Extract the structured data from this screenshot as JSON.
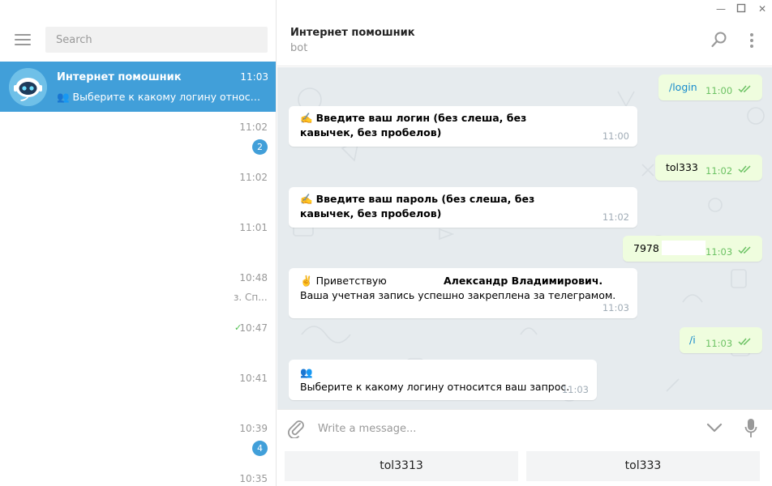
{
  "sidebar": {
    "search_placeholder": "Search",
    "active_chat": {
      "name": "Интернет помошник",
      "time": "11:03",
      "preview": "Выберите к какому логину относит..."
    },
    "chats": [
      {
        "time": "11:02",
        "badge": "2"
      },
      {
        "time": "11:02"
      },
      {
        "time": "11:01"
      },
      {
        "time": "10:48",
        "snippet": "з. Сп..."
      },
      {
        "time": "10:47"
      },
      {
        "time": "10:41"
      },
      {
        "time": "10:39",
        "badge": "4"
      },
      {
        "time": "10:35"
      }
    ]
  },
  "chat": {
    "title": "Интернет помошник",
    "subtitle": "bot",
    "messages": [
      {
        "dir": "out",
        "text": "/login",
        "time": "11:00"
      },
      {
        "dir": "in",
        "emoji": "✍️",
        "text": "Введите ваш логин (без слеша, без кавычек, без пробелов)",
        "time": "11:00"
      },
      {
        "dir": "out",
        "text": "tol333",
        "time": "11:02"
      },
      {
        "dir": "in",
        "emoji": "✍️",
        "text": "Введите ваш пароль (без слеша, без кавычек, без пробелов)",
        "time": "11:02"
      },
      {
        "dir": "out",
        "text": "7978",
        "time": "11:03"
      },
      {
        "dir": "in",
        "emoji": "✌️",
        "line1a": "Приветствую",
        "line1b": "Александр Владимирович.",
        "line2": "Ваша учетная запись успешно закреплена за телеграмом.",
        "time": "11:03"
      },
      {
        "dir": "out",
        "text": "/i",
        "time": "11:03"
      },
      {
        "dir": "in",
        "emoji": "👥",
        "text": "Выберите к какому логину относится ваш запрос.",
        "time": "11:03"
      }
    ],
    "input_placeholder": "Write a message...",
    "keyboard": [
      "tol3313",
      "tol333"
    ]
  },
  "colors": {
    "accent": "#419fd9",
    "chat_bg": "#e6ebee",
    "outgoing_bubble": "#effdde",
    "check_green": "#6cc264"
  },
  "icons": [
    "menu-icon",
    "search-icon",
    "more-icon",
    "attach-icon",
    "chevron-down-icon",
    "mic-icon",
    "double-check-icon",
    "minimize-icon",
    "maximize-icon",
    "close-icon"
  ]
}
